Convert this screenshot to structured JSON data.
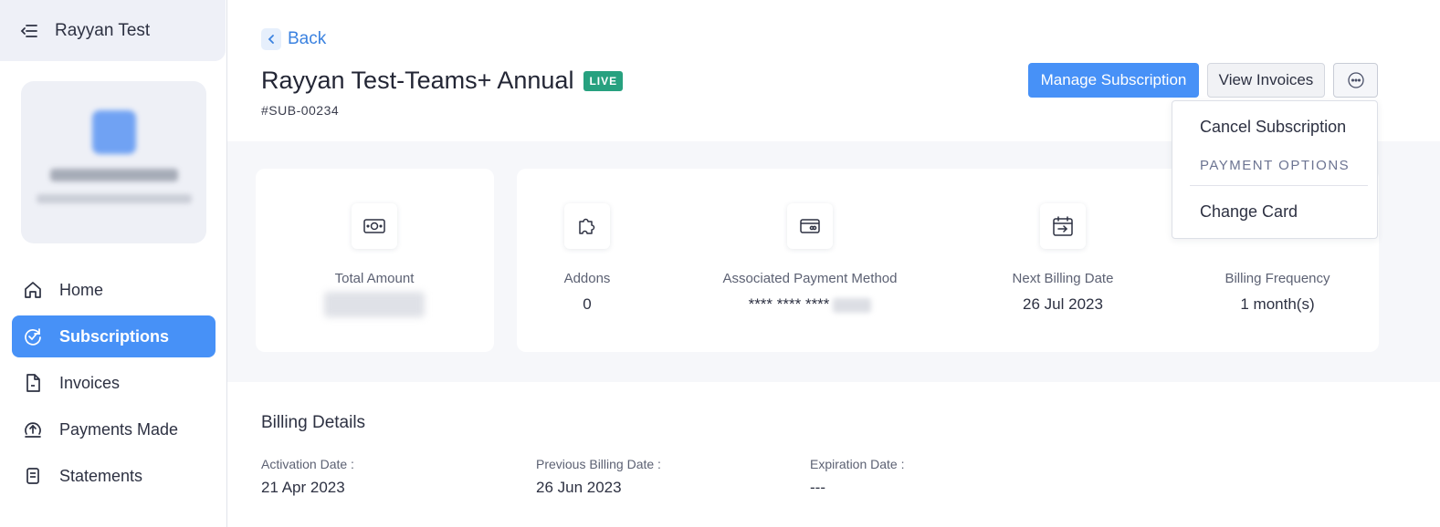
{
  "sidebar": {
    "org_name": "Rayyan Test",
    "nav": [
      {
        "label": "Home",
        "icon": "home-icon"
      },
      {
        "label": "Subscriptions",
        "icon": "subscriptions-icon",
        "active": true
      },
      {
        "label": "Invoices",
        "icon": "invoice-icon"
      },
      {
        "label": "Payments Made",
        "icon": "payment-upload-icon"
      },
      {
        "label": "Statements",
        "icon": "statement-icon"
      }
    ]
  },
  "header": {
    "back_label": "Back",
    "title": "Rayyan Test-Teams+ Annual",
    "status_badge": "LIVE",
    "subscription_id": "#SUB-00234",
    "manage_label": "Manage Subscription",
    "view_invoices_label": "View Invoices"
  },
  "dropdown": {
    "cancel_label": "Cancel Subscription",
    "section_label": "PAYMENT OPTIONS",
    "change_card_label": "Change Card"
  },
  "stats": {
    "total_amount": {
      "label": "Total Amount",
      "icon": "money-icon"
    },
    "addons": {
      "label": "Addons",
      "value": "0",
      "icon": "puzzle-icon"
    },
    "payment_method": {
      "label": "Associated Payment Method",
      "value": "**** **** ****",
      "icon": "card-icon"
    },
    "next_billing": {
      "label": "Next Billing Date",
      "value": "26 Jul 2023",
      "icon": "calendar-arrow-icon"
    },
    "frequency": {
      "label": "Billing Frequency",
      "value": "1 month(s)"
    }
  },
  "billing": {
    "heading": "Billing Details",
    "activation": {
      "label": "Activation Date :",
      "value": "21 Apr 2023"
    },
    "previous": {
      "label": "Previous Billing Date :",
      "value": "26 Jun 2023"
    },
    "expiration": {
      "label": "Expiration Date :",
      "value": "---"
    }
  },
  "colors": {
    "accent": "#4791f7",
    "live_badge": "#27a17f",
    "link": "#3b82e0"
  }
}
